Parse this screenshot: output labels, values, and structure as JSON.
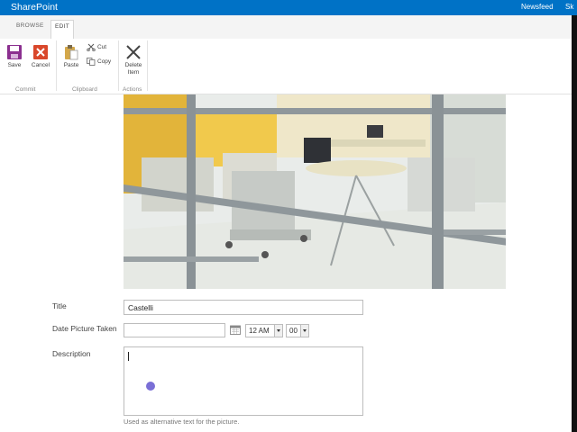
{
  "suite_bar": {
    "brand": "SharePoint",
    "newsfeed": "Newsfeed",
    "user_initial": "Sk",
    "color": "#0072c6"
  },
  "ribbon": {
    "tabs": [
      {
        "label": "BROWSE"
      },
      {
        "label": "EDIT",
        "selected": true
      }
    ],
    "commit": {
      "save_label": "Save",
      "cancel_label": "Cancel",
      "group_label": "Commit"
    },
    "clipboard": {
      "paste_label": "Paste",
      "cut_label": "Cut",
      "copy_label": "Copy",
      "group_label": "Clipboard"
    },
    "actions": {
      "delete_label": "Delete Item",
      "group_label": "Actions"
    }
  },
  "form": {
    "title": {
      "label": "Title",
      "value": "Castelli"
    },
    "date_taken": {
      "label": "Date Picture Taken",
      "date_value": "",
      "hour": "12 AM",
      "minute": "00"
    },
    "description": {
      "label": "Description",
      "value": "",
      "hint": "Used as alternative text for the picture."
    }
  },
  "icons": {
    "save": "save-icon",
    "cancel": "cancel-icon",
    "paste": "paste-icon",
    "cut": "scissors-icon",
    "copy": "copy-icon",
    "delete": "delete-icon",
    "calendar": "calendar-icon"
  }
}
